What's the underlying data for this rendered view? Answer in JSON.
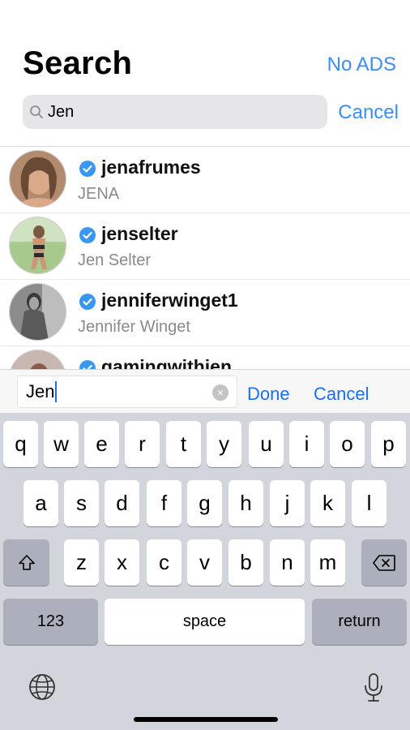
{
  "header": {
    "title": "Search",
    "no_ads_label": "No ADS",
    "search_value": "Jen",
    "cancel_label": "Cancel"
  },
  "results": [
    {
      "username": "jenafrumes",
      "full_name": "JENA",
      "verified": true
    },
    {
      "username": "jenselter",
      "full_name": "Jen Selter",
      "verified": true
    },
    {
      "username": "jenniferwinget1",
      "full_name": "Jennifer Winget",
      "verified": true
    },
    {
      "username": "gamingwithjen",
      "full_name": "",
      "verified": true
    }
  ],
  "accessory": {
    "input_value": "Jen",
    "clear_icon": "×",
    "done_label": "Done",
    "cancel_label": "Cancel"
  },
  "keyboard": {
    "row1": [
      "q",
      "w",
      "e",
      "r",
      "t",
      "y",
      "u",
      "i",
      "o",
      "p"
    ],
    "row2": [
      "a",
      "s",
      "d",
      "f",
      "g",
      "h",
      "j",
      "k",
      "l"
    ],
    "row3": [
      "z",
      "x",
      "c",
      "v",
      "b",
      "n",
      "m"
    ],
    "numbers_label": "123",
    "space_label": "space",
    "return_label": "return"
  },
  "colors": {
    "accent": "#3b8ef0",
    "verified": "#3897f0",
    "keyboard_bg": "#d2d5db"
  }
}
